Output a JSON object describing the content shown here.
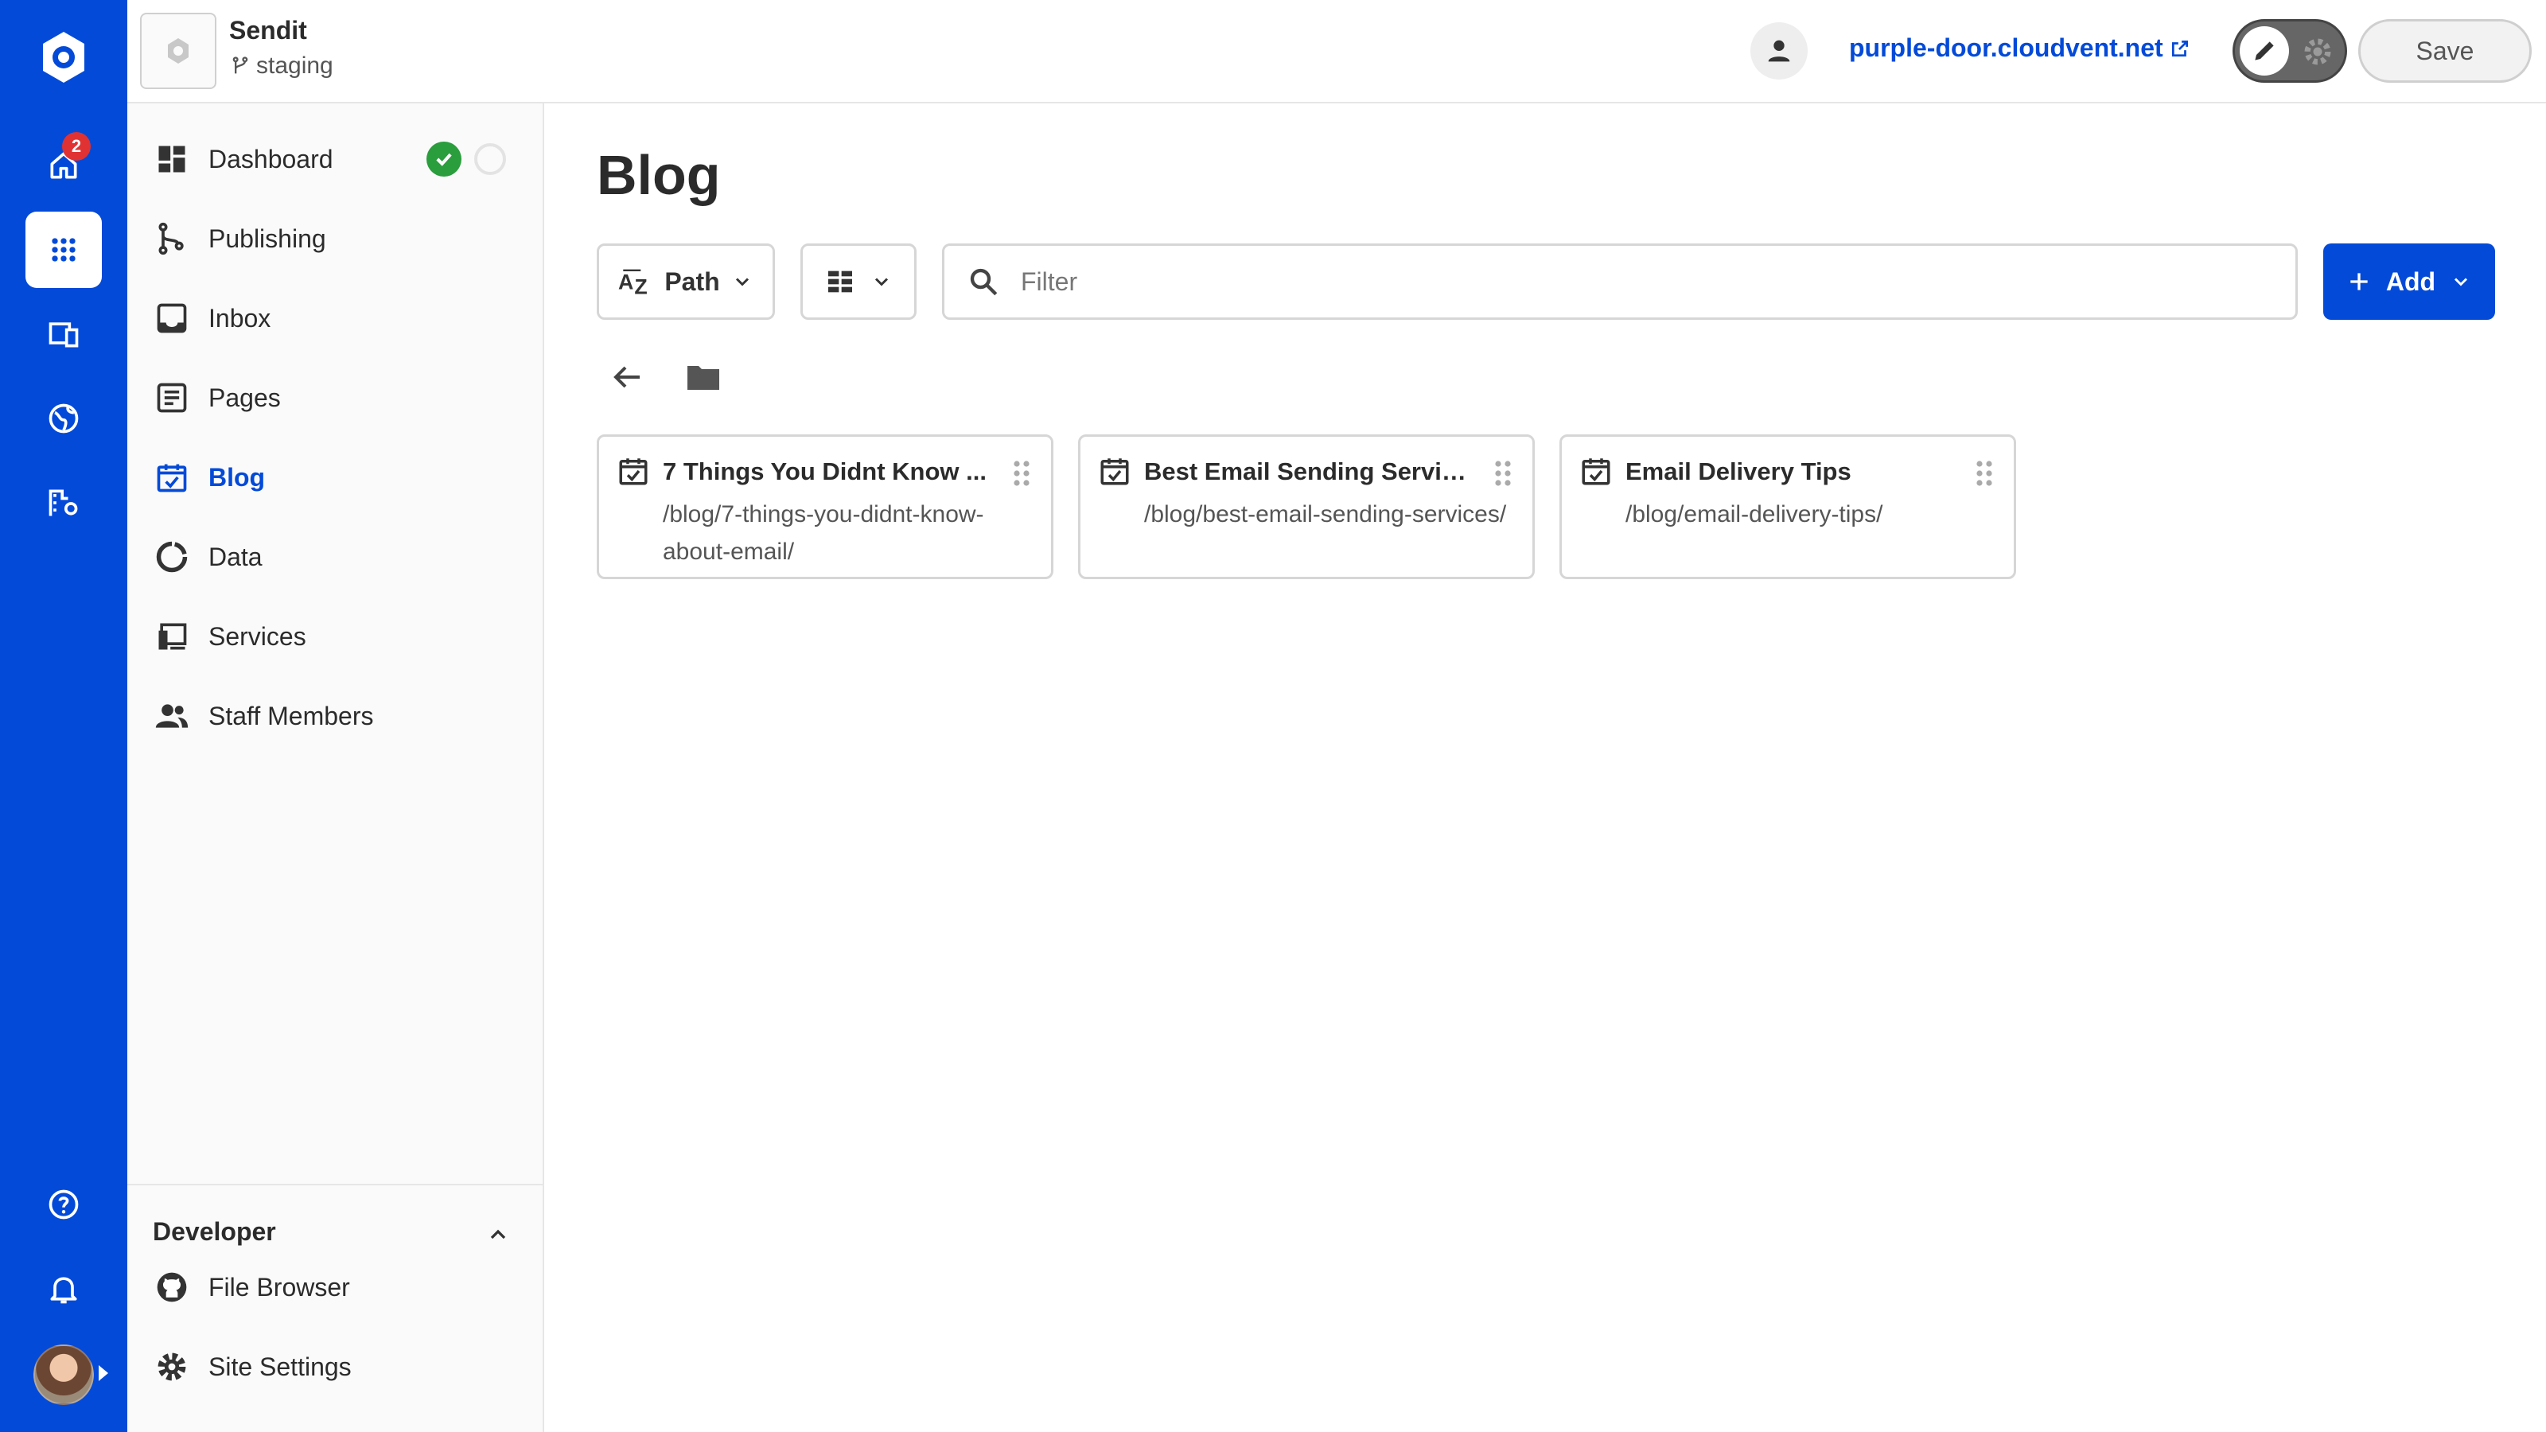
{
  "app": {
    "site_name": "Sendit",
    "branch": "staging",
    "site_url": "purple-door.cloudvent.net",
    "save_label": "Save",
    "notification_count": "2",
    "accent_color": "#034ad8"
  },
  "sidebar": {
    "items": [
      {
        "label": "Dashboard",
        "icon": "dashboard-icon"
      },
      {
        "label": "Publishing",
        "icon": "publishing-icon"
      },
      {
        "label": "Inbox",
        "icon": "inbox-icon"
      },
      {
        "label": "Pages",
        "icon": "pages-icon"
      },
      {
        "label": "Blog",
        "icon": "blog-calendar-icon",
        "active": true
      },
      {
        "label": "Data",
        "icon": "data-icon"
      },
      {
        "label": "Services",
        "icon": "services-icon"
      },
      {
        "label": "Staff Members",
        "icon": "people-icon"
      }
    ],
    "developer": {
      "title": "Developer",
      "items": [
        {
          "label": "File Browser",
          "icon": "github-icon"
        },
        {
          "label": "Site Settings",
          "icon": "gear-icon"
        }
      ]
    }
  },
  "main": {
    "title": "Blog",
    "sort_label": "Path",
    "filter_placeholder": "Filter",
    "add_label": "Add",
    "cards": [
      {
        "title": "7 Things You Didnt Know ...",
        "path": "/blog/7-things-you-didnt-know-about-email/"
      },
      {
        "title": "Best Email Sending Services",
        "path": "/blog/best-email-sending-services/"
      },
      {
        "title": "Email Delivery Tips",
        "path": "/blog/email-delivery-tips/"
      }
    ]
  }
}
